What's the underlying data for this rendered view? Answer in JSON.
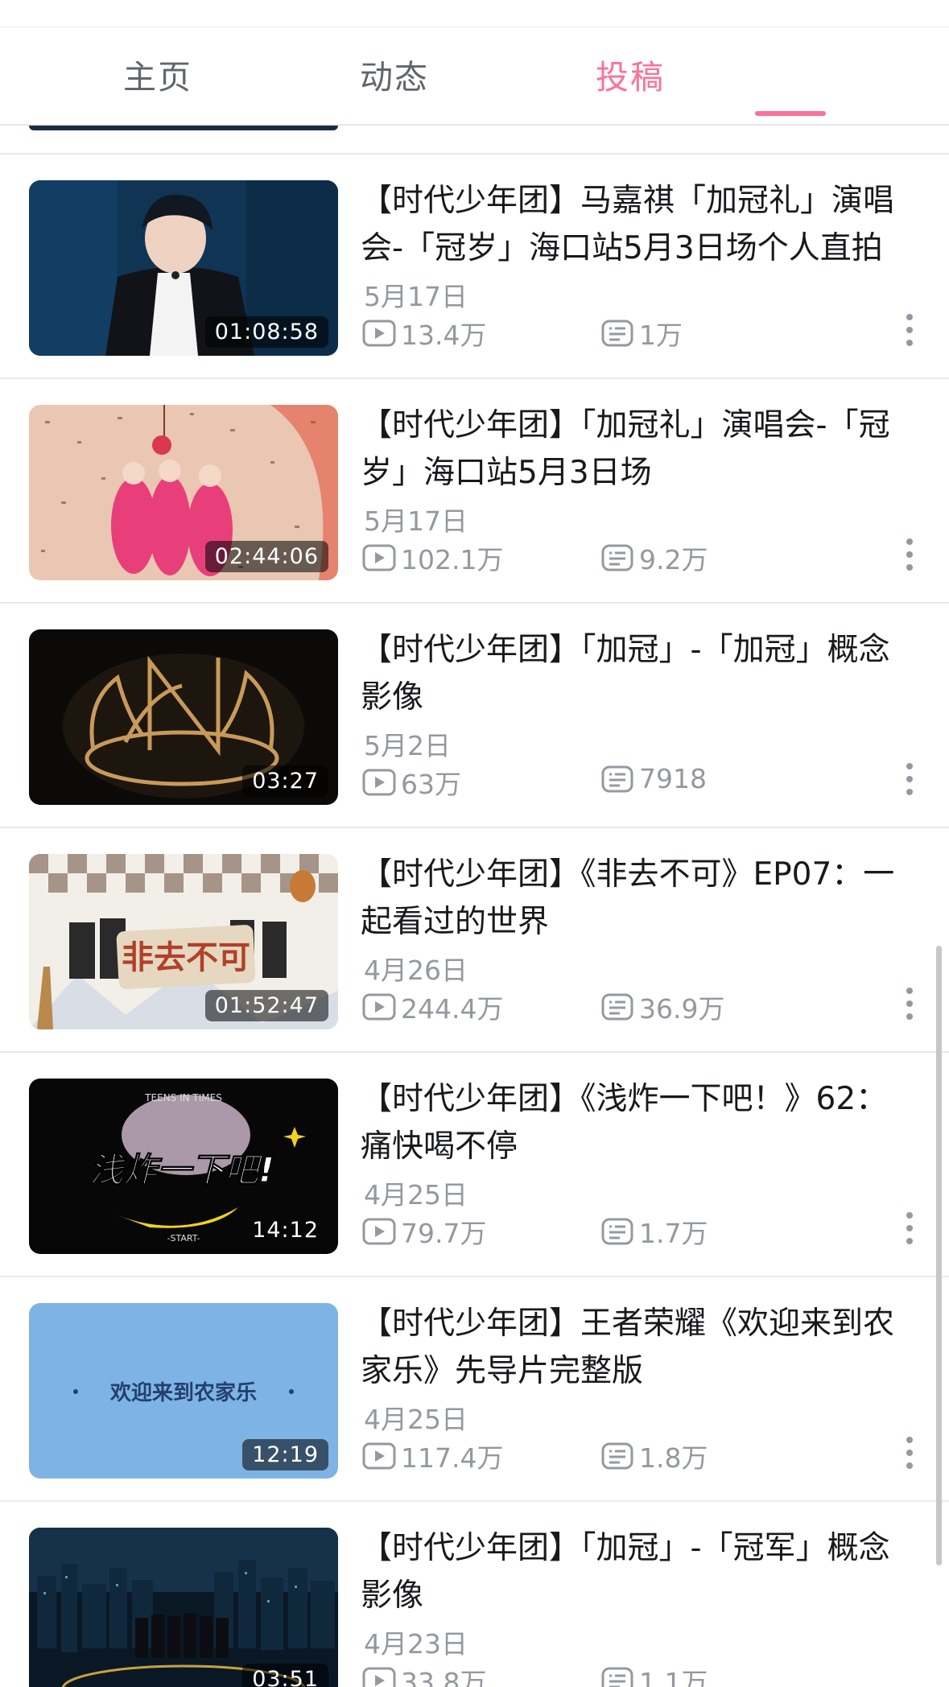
{
  "tabs": [
    {
      "label": "主页",
      "active": false
    },
    {
      "label": "动态",
      "active": false
    },
    {
      "label": "投稿",
      "active": true
    }
  ],
  "colors": {
    "accent": "#fb7299",
    "meta": "#9499a0",
    "title": "#18191c"
  },
  "videos": [
    {
      "title": "【时代少年团】马嘉祺「加冠礼」演唱会-「冠岁」海口站5月3日场个人直拍",
      "date": "5月17日",
      "views": "13.4万",
      "danmaku": "1万",
      "duration": "01:08:58"
    },
    {
      "title": "【时代少年团】「加冠礼」演唱会-「冠岁」海口站5月3日场",
      "date": "5月17日",
      "views": "102.1万",
      "danmaku": "9.2万",
      "duration": "02:44:06"
    },
    {
      "title": "【时代少年团】「加冠」-「加冠」概念影像",
      "date": "5月2日",
      "views": "63万",
      "danmaku": "7918",
      "duration": "03:27"
    },
    {
      "title": "【时代少年团】《非去不可》EP07：一起看过的世界",
      "date": "4月26日",
      "views": "244.4万",
      "danmaku": "36.9万",
      "duration": "01:52:47"
    },
    {
      "title": "【时代少年团】《浅炸一下吧！》62：痛快喝不停",
      "date": "4月25日",
      "views": "79.7万",
      "danmaku": "1.7万",
      "duration": "14:12"
    },
    {
      "title": "【时代少年团】王者荣耀《欢迎来到农家乐》先导片完整版",
      "date": "4月25日",
      "views": "117.4万",
      "danmaku": "1.8万",
      "duration": "12:19"
    },
    {
      "title": "【时代少年团】「加冠」-「冠军」概念影像",
      "date": "4月23日",
      "views": "33.8万",
      "danmaku": "1.1万",
      "duration": "03:51"
    }
  ],
  "thumb_text": {
    "v5_top": "TEENS IN TIMES",
    "v5_logo": "浅炸一下吧!",
    "v5_start": "-START-",
    "v6_center": "欢迎来到农家乐",
    "v4_logo": "非去不可"
  },
  "icons": {
    "views": "play-count-icon",
    "danmaku": "danmaku-icon",
    "more": "more-vertical-icon"
  }
}
